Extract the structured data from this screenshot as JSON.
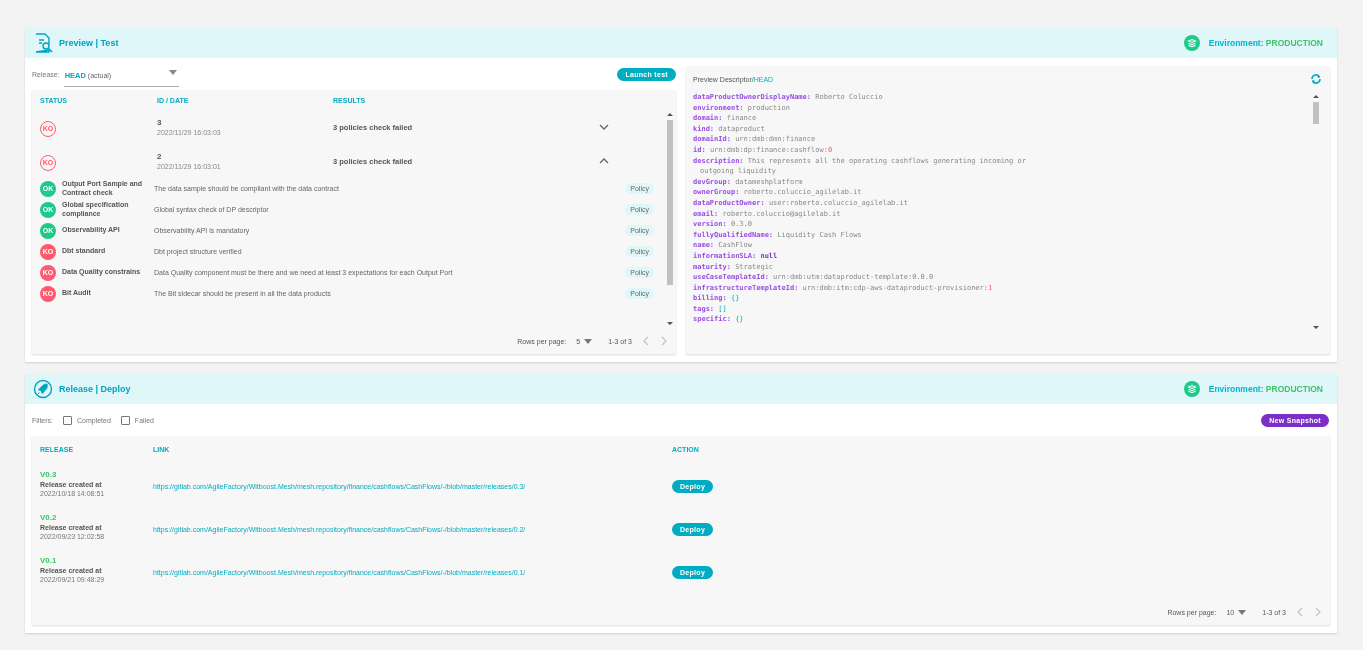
{
  "test_section": {
    "title": "Preview | Test",
    "environment_label": "Environment:",
    "environment": "PRODUCTION",
    "release_label": "Release:",
    "release_value": "HEAD",
    "release_note": "(actual)",
    "launch_button": "Launch test",
    "columns": [
      "STATUS",
      "ID / DATE",
      "RESULTS"
    ],
    "runs": [
      {
        "status": "KO",
        "passed": false,
        "id": "3",
        "date": "2022/11/29 16:03:03",
        "result": "3 policies check failed",
        "expanded": false
      },
      {
        "status": "KO",
        "passed": false,
        "id": "2",
        "date": "2022/11/29 16:03:01",
        "result": "3 policies check failed",
        "expanded": true,
        "checks": [
          {
            "status": "OK",
            "passed": true,
            "name": "Output Port Sample and Contract check",
            "description": "The data sample should be compliant with the data contract",
            "tag": "Policy"
          },
          {
            "status": "OK",
            "passed": true,
            "name": "Global specification compliance",
            "description": "Global syntax check of DP descriptor",
            "tag": "Policy"
          },
          {
            "status": "OK",
            "passed": true,
            "name": "Observability API",
            "description": "Observability API is mandatory",
            "tag": "Policy"
          },
          {
            "status": "KO",
            "passed": false,
            "name": "Dbt standard",
            "description": "Dbt project structure verified",
            "tag": "Policy"
          },
          {
            "status": "KO",
            "passed": false,
            "name": "Data Quality constrains",
            "description": "Data Quality component must be there and we need at least 3 expectations for each Output Port",
            "tag": "Policy"
          },
          {
            "status": "KO",
            "passed": false,
            "name": "Bit Audit",
            "description": "The Bit sidecar should be present in all the data products",
            "tag": "Policy"
          }
        ]
      }
    ],
    "pagination": {
      "label": "Rows per page:",
      "value": "5",
      "range": "1-3 of 3"
    }
  },
  "descriptor": {
    "title": "Preview Descriptor/",
    "ref": "HEAD",
    "lines": [
      {
        "key": "dataProductOwnerDisplayName:",
        "value": [
          {
            "text": "Roberto Coluccio",
            "kind": "string"
          }
        ]
      },
      {
        "key": "environment:",
        "value": [
          {
            "text": "production",
            "kind": "string"
          }
        ]
      },
      {
        "key": "domain:",
        "value": [
          {
            "text": "finance",
            "kind": "string"
          }
        ]
      },
      {
        "key": "kind:",
        "value": [
          {
            "text": "dataproduct",
            "kind": "string"
          }
        ]
      },
      {
        "key": "domainId:",
        "value": [
          {
            "text": "urn:dmb:dmn:finance",
            "kind": "string"
          }
        ]
      },
      {
        "key": "id:",
        "value": [
          {
            "text": "urn:dmb:dp:finance:cashflow:",
            "kind": "string"
          },
          {
            "text": "0",
            "kind": "number"
          }
        ]
      },
      {
        "key": "description:",
        "value": [
          {
            "text": "This represents all the operating cashflows generating incoming or",
            "kind": "string"
          }
        ]
      },
      {
        "value": [
          {
            "text": "outgoing liquidity",
            "kind": "string"
          }
        ]
      },
      {
        "key": "devGroup:",
        "value": [
          {
            "text": "datameshplatform",
            "kind": "string"
          }
        ]
      },
      {
        "key": "ownerGroup:",
        "value": [
          {
            "text": "roberto.coluccio_agilelab.it",
            "kind": "string"
          }
        ]
      },
      {
        "key": "dataProductOwner:",
        "value": [
          {
            "text": "user:roberto.coluccio_agilelab.it",
            "kind": "string"
          }
        ]
      },
      {
        "key": "email:",
        "value": [
          {
            "text": "roberto.coluccio@agilelab.it",
            "kind": "string"
          }
        ]
      },
      {
        "key": "version:",
        "value": [
          {
            "text": "0.3.0",
            "kind": "string"
          }
        ]
      },
      {
        "key": "fullyQualifiedName:",
        "value": [
          {
            "text": "Liquidity Cash Flows",
            "kind": "string"
          }
        ]
      },
      {
        "key": "name:",
        "value": [
          {
            "text": "CashFlow",
            "kind": "string"
          }
        ]
      },
      {
        "key": "informationSLA:",
        "value": [
          {
            "text": "null",
            "kind": "keyword"
          }
        ]
      },
      {
        "key": "maturity:",
        "value": [
          {
            "text": "Strategic",
            "kind": "string"
          }
        ]
      },
      {
        "key": "useCaseTemplateId:",
        "value": [
          {
            "text": "urn:dmb:utm:dataproduct-template:0.0.0",
            "kind": "string"
          }
        ]
      },
      {
        "key": "infrastructureTemplateId:",
        "value": [
          {
            "text": "urn:dmb:itm:cdp-aws-dataproduct-provisioner:",
            "kind": "string"
          },
          {
            "text": "1",
            "kind": "number"
          }
        ]
      },
      {
        "key": "billing:",
        "value": [
          {
            "text": "{}",
            "kind": "bracket"
          }
        ]
      },
      {
        "key": "tags:",
        "value": [
          {
            "text": "[]",
            "kind": "bracket"
          }
        ]
      },
      {
        "key": "specific:",
        "value": [
          {
            "text": "{}",
            "kind": "bracket"
          }
        ]
      }
    ]
  },
  "deploy_section": {
    "title": "Release | Deploy",
    "environment_label": "Environment:",
    "environment": "PRODUCTION",
    "filters_label": "Filters:",
    "filters": [
      {
        "label": "Completed",
        "checked": false
      },
      {
        "label": "Failed",
        "checked": false
      }
    ],
    "new_snapshot_button": "New Snapshot",
    "columns": [
      "RELEASE",
      "LINK",
      "ACTION"
    ],
    "releases": [
      {
        "version": "V0.3",
        "created_label": "Release created at",
        "date": "2022/10/18 14:08:51",
        "link": "https://gitlab.com/AgileFactory/Witboost.Mesh/mesh.repository/finance/cashflows/CashFlows/-/blob/master/releases/0.3/",
        "action": "Deploy"
      },
      {
        "version": "V0.2",
        "created_label": "Release created at",
        "date": "2022/09/23 12:02:58",
        "link": "https://gitlab.com/AgileFactory/Witboost.Mesh/mesh.repository/finance/cashflows/CashFlows/-/blob/master/releases/0.2/",
        "action": "Deploy"
      },
      {
        "version": "V0.1",
        "created_label": "Release created at",
        "date": "2022/09/21 09:48:29",
        "link": "https://gitlab.com/AgileFactory/Witboost.Mesh/mesh.repository/finance/cashflows/CashFlows/-/blob/master/releases/0.1/",
        "action": "Deploy"
      }
    ],
    "pagination": {
      "label": "Rows per page:",
      "value": "10",
      "range": "1-3 of 3"
    }
  }
}
